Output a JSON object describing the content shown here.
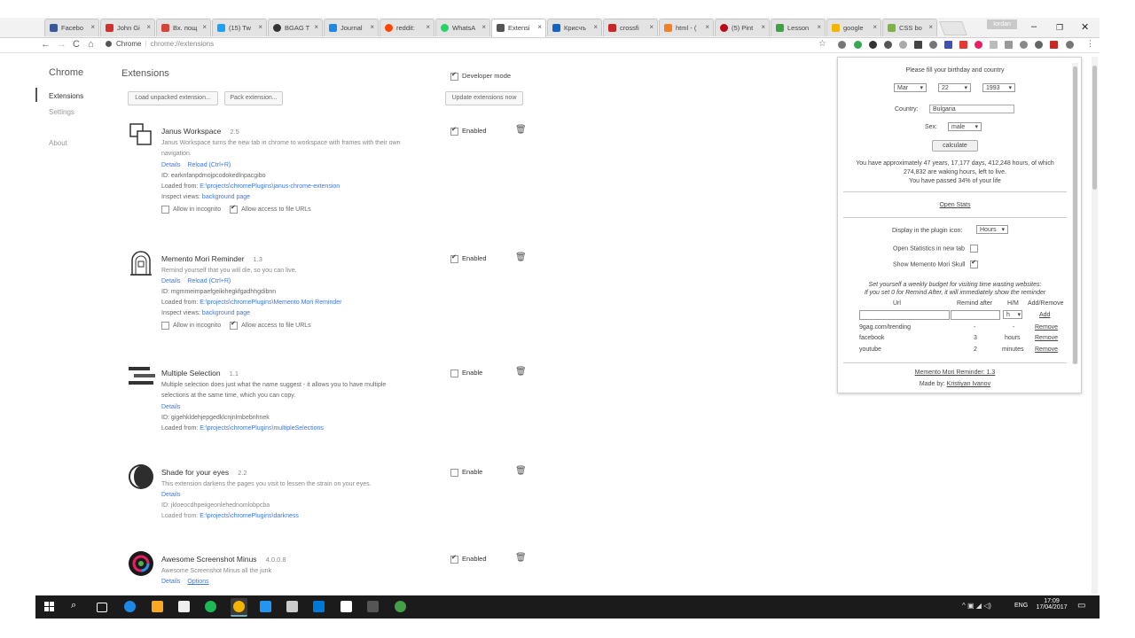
{
  "tabs": [
    {
      "label": "Facebo",
      "color": "#3b5998"
    },
    {
      "label": "John Gi",
      "color": "#d32f2f"
    },
    {
      "label": "Вх. пощ",
      "color": "#d44638"
    },
    {
      "label": "(15) Tw",
      "color": "#1da1f2"
    },
    {
      "label": "BGAG T",
      "color": "#333"
    },
    {
      "label": "Journal",
      "color": "#1e88e5"
    },
    {
      "label": "reddit:",
      "color": "#ff4500"
    },
    {
      "label": "WhatsA",
      "color": "#25d366"
    },
    {
      "label": "Extensi",
      "color": "#555"
    },
    {
      "label": "Крисчъ",
      "color": "#1565c0"
    },
    {
      "label": "crossfi",
      "color": "#c62828"
    },
    {
      "label": "html - (",
      "color": "#f48024"
    },
    {
      "label": "(5) Pint",
      "color": "#bd081c"
    },
    {
      "label": "Lesson",
      "color": "#43a047"
    },
    {
      "label": "google",
      "color": "#f4b400"
    },
    {
      "label": "CSS bo",
      "color": "#7cb342"
    }
  ],
  "window": {
    "profile": "Iordan",
    "min": "–",
    "max": "❐",
    "close": "✕"
  },
  "toolbar": {
    "back": "←",
    "forward": "→",
    "reload": "C",
    "home": "⌂",
    "scheme": "Chrome",
    "url": "chrome://extensions",
    "star": "☆"
  },
  "sidebar": {
    "title": "Chrome",
    "items": [
      "Extensions",
      "Settings",
      "About"
    ]
  },
  "page": {
    "heading": "Extensions",
    "dev_mode": "Developer mode",
    "load_unpacked": "Load unpacked extension...",
    "pack": "Pack extension...",
    "update": "Update extensions now"
  },
  "extensions": [
    {
      "name": "Janus Workspace",
      "version": "2.5",
      "desc": "Janus Workspace turns the new tab in chrome to workspace with frames with their own",
      "desc2": "navigation.",
      "details": "Details",
      "reload": "Reload (Ctrl+R)",
      "id": "ID: earknfanpdmojpcodokedlnpacgibo",
      "loaded_label": "Loaded from:",
      "loaded": "E:\\projects\\chromePlugins\\janus-chrome-extension",
      "inspect_label": "Inspect views:",
      "inspect": "background page",
      "incognito": "Allow in incognito",
      "file": "Allow access to file URLs",
      "status": "Enabled"
    },
    {
      "name": "Memento Mori Reminder",
      "version": "1.3",
      "desc": "Remind yourself that you will die, so you can live.",
      "details": "Details",
      "reload": "Reload (Ctrl+R)",
      "id": "ID: mgmmeimpaefgeikihegkfgadhhgdibnn",
      "loaded_label": "Loaded from:",
      "loaded": "E:\\projects\\chromePlugins\\Memento Mori Reminder",
      "inspect_label": "Inspect views:",
      "inspect": "background page",
      "incognito": "Allow in incognito",
      "file": "Allow access to file URLs",
      "status": "Enabled"
    },
    {
      "name": "Multiple Selection",
      "version": "1.1",
      "desc": "Multiple selection does just what the name suggest - it allows you to have multiple",
      "desc2": "selections at the same time, which you can copy.",
      "details": "Details",
      "id": "ID: gigehkldehjepgedklcnjnlmbebnhnek",
      "loaded_label": "Loaded from:",
      "loaded": "E:\\projects\\chromePlugins\\multipleSelections",
      "status": "Enable"
    },
    {
      "name": "Shade for your eyes",
      "version": "2.2",
      "desc": "This extension darkens the pages you visit to lessen the strain on your eyes.",
      "details": "Details",
      "id": "ID: jkloeocdhpeiigeonlehednomlobpcba",
      "loaded_label": "Loaded from:",
      "loaded": "E:\\projects\\chromePlugins\\darkness",
      "status": "Enable"
    },
    {
      "name": "Awesome Screenshot Minus",
      "version": "4.0.0.8",
      "desc": "Awesome Screenshot Minus all the junk",
      "details": "Details",
      "options": "Options",
      "status": "Enabled"
    }
  ],
  "popup": {
    "prompt": "Please fill your birthday and country",
    "month": "Mar",
    "day": "22",
    "year": "1993",
    "country_label": "Country:",
    "country": "Bulgaria",
    "sex_label": "Sex:",
    "sex": "male",
    "calculate": "calculate",
    "result1": "You have approximately 47 years, 17,177 days, 412,248 hours, of which",
    "result2": "274,832 are waking hours, left to live.",
    "result3": "You have passed 34% of your life",
    "open_stats": "Open Stats",
    "display_label": "Display in the plugin icon:",
    "display": "Hours",
    "open_new_tab": "Open Statistics in new tab",
    "show_skull": "Show Memento Mori Skull",
    "budget1": "Set yourself a weekly budget for visiting time wasting websites:",
    "budget2": "If you set 0 for Remind After, it will immediately show the reminder",
    "col_url": "Url",
    "col_remind": "Remind after",
    "col_hm": "H/M",
    "col_add": "Add/Remove",
    "hm_sel": "h",
    "add": "Add",
    "rows": [
      {
        "url": "9gag.com/trending",
        "after": "-",
        "unit": "-",
        "action": "Remove"
      },
      {
        "url": "facebook",
        "after": "3",
        "unit": "hours",
        "action": "Remove"
      },
      {
        "url": "youtube",
        "after": "2",
        "unit": "minutes",
        "action": "Remove"
      }
    ],
    "footer1": "Memento Mori Reminder: 1.3",
    "footer2_label": "Made by:",
    "footer2": "Kristiyan Ivanov"
  },
  "taskbar": {
    "lang": "ENG",
    "time": "17:09",
    "date": "17/04/2017",
    "icons": [
      "start",
      "search",
      "task-view",
      "edge",
      "explorer",
      "store",
      "spotify",
      "chrome",
      "vscode",
      "photos",
      "visual-studio",
      "cmd",
      "tool",
      "node"
    ]
  }
}
